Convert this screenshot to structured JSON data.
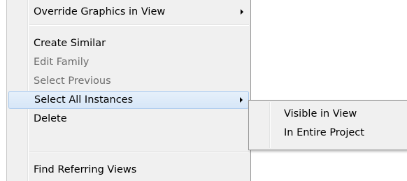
{
  "context_menu": {
    "items": [
      {
        "label": "Override Graphics in View",
        "has_submenu": true
      },
      {
        "label": "Create Similar"
      },
      {
        "label": "Edit Family",
        "disabled": true
      },
      {
        "label": "Select Previous",
        "disabled": true
      },
      {
        "label": "Select All Instances",
        "has_submenu": true,
        "highlighted": true
      },
      {
        "label": "Delete"
      },
      {
        "label": "Find Referring Views"
      }
    ]
  },
  "submenu": {
    "parent": "Select All Instances",
    "items": [
      {
        "label": "Visible in View"
      },
      {
        "label": "In Entire Project"
      }
    ]
  },
  "colors": {
    "menu_background": "#f0f0f0",
    "highlight_fill": "#dbe9f9",
    "highlight_border": "#a8c8ec",
    "disabled_text": "#6d6d6d"
  },
  "icons": {
    "submenu_arrow": "chevron-right-icon"
  }
}
